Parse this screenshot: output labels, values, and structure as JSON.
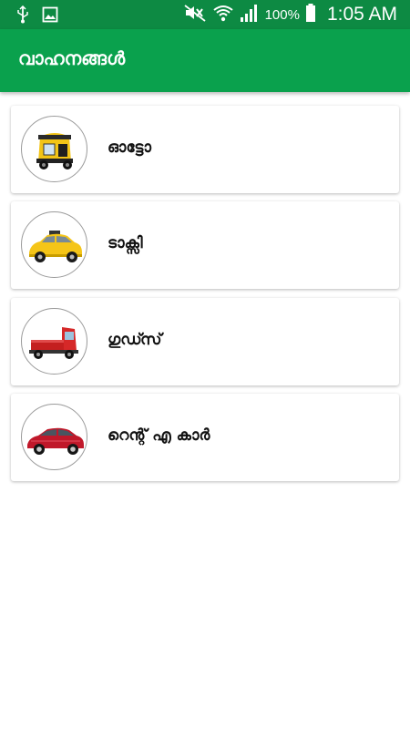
{
  "status_bar": {
    "battery_percent": "100%",
    "time": "1:05 AM",
    "icons": [
      "usb-icon",
      "image-icon",
      "mute-icon",
      "wifi-icon",
      "signal-icon",
      "battery-icon"
    ]
  },
  "app_bar": {
    "title": "വാഹനങ്ങൾ",
    "color": "#0aa14d"
  },
  "vehicles": [
    {
      "label": "ഓട്ടോ",
      "icon": "auto-rickshaw-icon"
    },
    {
      "label": "ടാക്സി",
      "icon": "taxi-icon"
    },
    {
      "label": "ഗുഡ്സ്",
      "icon": "goods-vehicle-icon"
    },
    {
      "label": "റെന്റ് എ കാർ",
      "icon": "rental-car-icon"
    }
  ]
}
